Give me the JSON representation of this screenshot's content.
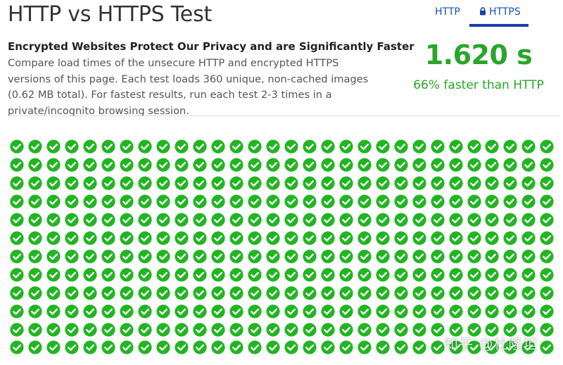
{
  "page": {
    "title": "HTTP vs HTTPS Test"
  },
  "tabs": [
    {
      "label": "HTTP",
      "active": false
    },
    {
      "label": "HTTPS",
      "active": true,
      "icon": "lock-icon"
    }
  ],
  "intro": {
    "heading": "Encrypted Websites Protect Our Privacy and are Significantly Faster",
    "description": "Compare load times of the unsecure HTTP and encrypted HTTPS versions of this page. Each test loads 360 unique, non-cached images (0.62 MB total). For fastest results, run each test 2-3 times in a private/incognito browsing session."
  },
  "result": {
    "time": "1.620 s",
    "comparison": "66% faster than HTTP"
  },
  "image_grid": {
    "columns": 30,
    "rows": 12,
    "status": "loaded",
    "icon": "check-circle-icon"
  },
  "watermark": "知乎 @杜隆坦",
  "colors": {
    "success": "#2aa52a",
    "link": "#1a4fb4",
    "tab_underline": "#1a3ea8",
    "check_fill": "#22b522"
  }
}
